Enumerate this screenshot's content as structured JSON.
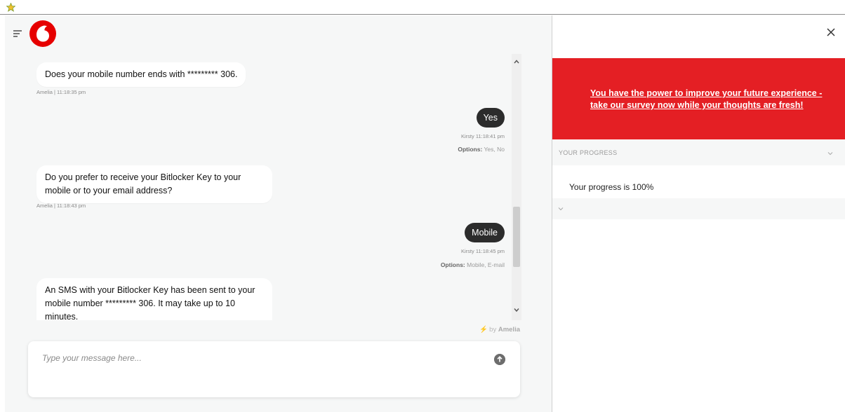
{
  "window": {
    "icon": "app-star-icon"
  },
  "chat": {
    "menu_icon": "hamburger-menu-icon",
    "logo": "vodafone-logo",
    "messages": [
      {
        "from": "bot",
        "text": "Does your mobile number ends with ********* 306.",
        "meta": "Amelia | 11:18:35 pm"
      },
      {
        "from": "user",
        "text": "Yes",
        "meta": "Kirsty 11:18:41 pm",
        "options_label": "Options:",
        "options": "Yes, No"
      },
      {
        "from": "bot",
        "text": "Do you prefer to receive your Bitlocker Key to your mobile or to your email address?",
        "meta": "Amelia | 11:18:43 pm"
      },
      {
        "from": "user",
        "text": "Mobile",
        "meta": "Kirsty 11:18:45 pm",
        "options_label": "Options:",
        "options": "Mobile, E-mail"
      },
      {
        "from": "bot",
        "text": "An SMS with your Bitlocker Key has been sent to your mobile number ********* 306. It may take up to 10 minutes."
      }
    ],
    "powered_by": {
      "prefix": "by",
      "brand": "Amelia"
    },
    "composer": {
      "placeholder": "Type your message here...",
      "send_icon": "send-arrow-up-icon"
    }
  },
  "side_panel": {
    "close_icon": "close-x-icon",
    "survey_link": "You have the power to improve your future experience - take our survey now while your thoughts are fresh!",
    "progress_header": "YOUR PROGRESS",
    "progress_text": "Your progress is 100%",
    "progress_value": 1.0
  },
  "colors": {
    "brand_red": "#e41f24",
    "user_bubble": "#2c2c2c",
    "pane_bg": "#f6f7f7"
  }
}
